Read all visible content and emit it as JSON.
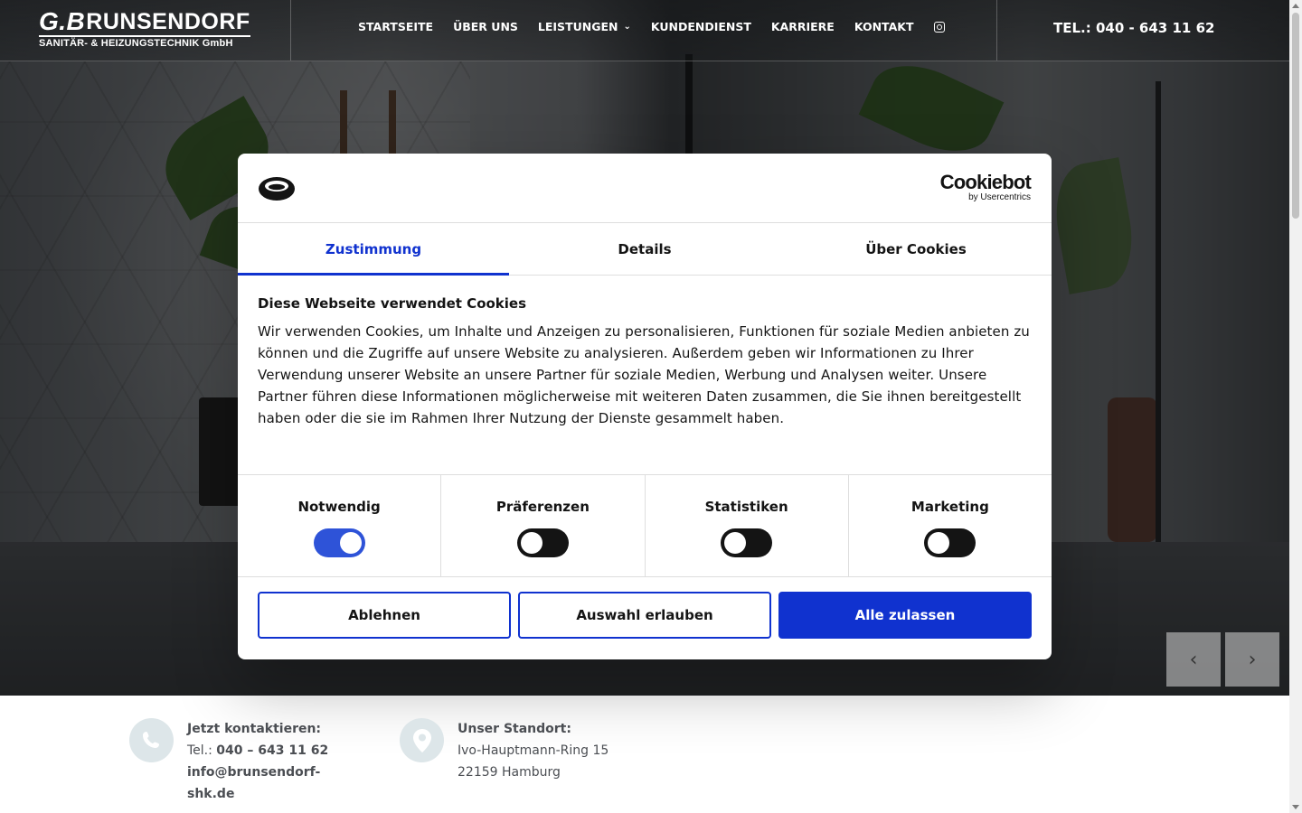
{
  "header": {
    "logo_initials": "G.B",
    "logo_brand": "RUNSENDORF",
    "logo_tagline": "SANITÄR- & HEIZUNGSTECHNIK GmbH",
    "nav": [
      "STARTSEITE",
      "ÜBER UNS",
      "LEISTUNGEN",
      "KUNDENDIENST",
      "KARRIERE",
      "KONTAKT"
    ],
    "phone": "TEL.: 040 - 643 11 62"
  },
  "cookie_dialog": {
    "brand": "Cookiebot",
    "brand_by": "by Usercentrics",
    "tabs": [
      "Zustimmung",
      "Details",
      "Über Cookies"
    ],
    "active_tab": "Zustimmung",
    "title": "Diese Webseite verwendet Cookies",
    "text": "Wir verwenden Cookies, um Inhalte und Anzeigen zu personalisieren, Funktionen für soziale Medien anbieten zu können und die Zugriffe auf unsere Website zu analysieren. Außerdem geben wir Informationen zu Ihrer Verwendung unserer Website an unsere Partner für soziale Medien, Werbung und Analysen weiter. Unsere Partner führen diese Informationen möglicherweise mit weiteren Daten zusammen, die Sie ihnen bereitgestellt haben oder die sie im Rahmen Ihrer Nutzung der Dienste gesammelt haben.",
    "categories": [
      {
        "label": "Notwendig",
        "enabled": true
      },
      {
        "label": "Präferenzen",
        "enabled": false
      },
      {
        "label": "Statistiken",
        "enabled": false
      },
      {
        "label": "Marketing",
        "enabled": false
      }
    ],
    "buttons": {
      "deny": "Ablehnen",
      "allow_selection": "Auswahl erlauben",
      "allow_all": "Alle zulassen"
    }
  },
  "slider": {
    "prev": "‹",
    "next": "›"
  },
  "contact": {
    "heading": "Jetzt kontaktieren:",
    "tel_label": "Tel.:",
    "tel": "040 – 643 11 62",
    "email_line1": "info@brunsendorf-",
    "email_line2": "shk.de"
  },
  "location": {
    "heading": "Unser Standort:",
    "street": "Ivo-Hauptmann-Ring 15",
    "city": "22159 Hamburg"
  },
  "colors": {
    "accent": "#1032cf",
    "toggle_on": "#2e53d8",
    "icon_circle": "#dde6e9"
  }
}
